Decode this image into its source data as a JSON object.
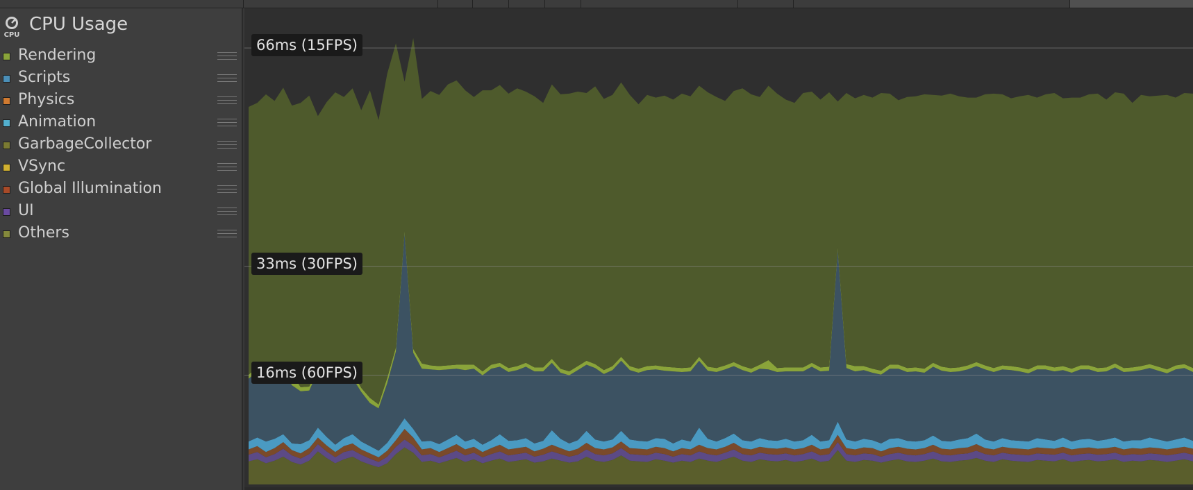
{
  "module": {
    "title": "CPU Usage",
    "icon": "cpu-gauge-icon",
    "icon_caption": "CPU"
  },
  "legend": [
    {
      "label": "Rendering",
      "color": "#8aa43a"
    },
    {
      "label": "Scripts",
      "color": "#4b8fb8"
    },
    {
      "label": "Physics",
      "color": "#d07a30"
    },
    {
      "label": "Animation",
      "color": "#53b0cf"
    },
    {
      "label": "GarbageCollector",
      "color": "#7a7a32"
    },
    {
      "label": "VSync",
      "color": "#d0b030"
    },
    {
      "label": "Global Illumination",
      "color": "#a84a28"
    },
    {
      "label": "UI",
      "color": "#6a4aa0"
    },
    {
      "label": "Others",
      "color": "#858a3c"
    }
  ],
  "chart_data": {
    "type": "area",
    "ylim": [
      0,
      72
    ],
    "y_markers": [
      {
        "label": "66ms (15FPS)",
        "value": 66
      },
      {
        "label": "33ms (30FPS)",
        "value": 33
      },
      {
        "label": "16ms (60FPS)",
        "value": 16.5
      }
    ],
    "series": [
      {
        "name": "Others",
        "color": "#5a5e2c",
        "values": [
          3.5,
          3.8,
          3.2,
          3.6,
          4.2,
          3.4,
          3.0,
          3.6,
          5.0,
          4.0,
          3.2,
          3.8,
          4.2,
          3.5,
          3.0,
          2.6,
          3.2,
          4.6,
          5.6,
          4.8,
          3.4,
          3.6,
          3.2,
          3.6,
          4.0,
          3.4,
          3.8,
          3.2,
          3.6,
          3.9,
          3.4,
          3.6,
          3.8,
          3.3,
          3.5,
          3.9,
          3.6,
          3.3,
          3.5,
          4.2,
          3.6,
          3.4,
          3.7,
          4.4,
          3.6,
          3.5,
          3.4,
          3.8,
          3.6,
          3.3,
          3.6,
          3.4,
          3.9,
          3.6,
          3.4,
          3.8,
          4.2,
          3.6,
          3.4,
          3.8,
          3.6,
          3.5,
          3.7,
          3.4,
          3.6,
          3.9,
          3.4,
          3.6,
          5.2,
          3.6,
          3.4,
          3.7,
          3.6,
          3.3,
          3.6,
          3.8,
          3.5,
          3.4,
          3.6,
          3.9,
          3.5,
          3.4,
          3.6,
          3.7,
          4.0,
          3.6,
          3.4,
          3.8,
          3.6,
          3.5,
          3.4,
          3.7,
          3.6,
          3.5,
          3.8,
          3.4,
          3.6,
          3.7,
          3.5,
          3.6,
          3.8,
          3.4,
          3.6,
          3.5,
          3.7,
          3.6,
          3.4,
          3.6,
          3.8,
          3.5
        ]
      },
      {
        "name": "UI",
        "color": "#5c4a86",
        "values": [
          1.0,
          1.1,
          0.9,
          1.0,
          1.2,
          1.0,
          0.9,
          1.0,
          1.1,
          1.0,
          0.9,
          1.1,
          1.0,
          1.0,
          0.9,
          0.8,
          1.0,
          1.1,
          1.2,
          1.1,
          1.0,
          1.0,
          0.9,
          1.0,
          1.1,
          1.0,
          1.0,
          0.9,
          1.0,
          1.1,
          1.0,
          1.0,
          1.0,
          0.9,
          1.0,
          1.1,
          1.0,
          0.9,
          1.0,
          1.1,
          1.0,
          1.0,
          1.0,
          1.1,
          1.0,
          1.0,
          1.0,
          1.0,
          1.0,
          0.9,
          1.0,
          1.0,
          1.1,
          1.0,
          1.0,
          1.0,
          1.1,
          1.0,
          1.0,
          1.0,
          1.0,
          1.0,
          1.0,
          1.0,
          1.0,
          1.1,
          1.0,
          1.0,
          1.2,
          1.0,
          1.0,
          1.0,
          1.0,
          0.9,
          1.0,
          1.0,
          1.0,
          1.0,
          1.0,
          1.1,
          1.0,
          1.0,
          1.0,
          1.0,
          1.1,
          1.0,
          1.0,
          1.0,
          1.0,
          1.0,
          1.0,
          1.0,
          1.0,
          1.0,
          1.0,
          1.0,
          1.0,
          1.0,
          1.0,
          1.0,
          1.0,
          1.0,
          1.0,
          1.0,
          1.0,
          1.0,
          1.0,
          1.0,
          1.0,
          1.0
        ]
      },
      {
        "name": "Global Illumination",
        "color": "#7a4a2a",
        "values": [
          0.8,
          0.9,
          0.8,
          0.9,
          1.0,
          0.8,
          0.8,
          0.9,
          1.0,
          0.9,
          0.8,
          0.9,
          1.0,
          0.8,
          0.8,
          0.7,
          0.9,
          1.0,
          1.6,
          1.2,
          0.9,
          0.9,
          0.8,
          0.9,
          1.0,
          0.9,
          0.9,
          0.8,
          0.9,
          1.0,
          0.9,
          0.9,
          0.9,
          0.8,
          0.9,
          1.0,
          0.9,
          0.8,
          0.9,
          1.0,
          0.9,
          0.9,
          0.9,
          1.0,
          0.9,
          0.9,
          0.9,
          0.9,
          0.9,
          0.8,
          0.9,
          0.9,
          1.0,
          0.9,
          0.9,
          0.9,
          1.0,
          0.9,
          0.9,
          0.9,
          0.9,
          0.9,
          0.9,
          0.9,
          0.9,
          1.0,
          0.9,
          0.9,
          1.1,
          0.9,
          0.9,
          0.9,
          0.9,
          0.8,
          0.9,
          0.9,
          0.9,
          0.9,
          0.9,
          1.0,
          0.9,
          0.9,
          0.9,
          0.9,
          1.0,
          0.9,
          0.9,
          0.9,
          0.9,
          0.9,
          0.9,
          0.9,
          0.9,
          0.9,
          0.9,
          0.9,
          0.9,
          0.9,
          0.9,
          0.9,
          0.9,
          0.9,
          0.9,
          0.9,
          0.9,
          0.9,
          0.9,
          0.9,
          0.9,
          0.9
        ]
      },
      {
        "name": "Animation",
        "color": "#4a9ac2",
        "values": [
          1.2,
          1.3,
          1.6,
          1.4,
          1.2,
          1.0,
          1.4,
          1.2,
          1.5,
          1.3,
          1.1,
          1.2,
          1.4,
          1.2,
          1.1,
          1.0,
          1.2,
          1.4,
          1.6,
          1.3,
          1.2,
          1.1,
          1.2,
          1.3,
          1.4,
          1.2,
          1.2,
          1.1,
          1.2,
          1.6,
          1.3,
          1.2,
          1.3,
          1.2,
          1.2,
          2.2,
          1.4,
          1.2,
          1.3,
          1.8,
          1.3,
          1.2,
          1.2,
          1.6,
          1.3,
          1.2,
          1.2,
          1.3,
          1.4,
          1.2,
          1.3,
          1.2,
          2.6,
          1.4,
          1.2,
          1.3,
          1.4,
          1.2,
          1.2,
          1.3,
          1.2,
          1.2,
          1.3,
          1.2,
          1.2,
          1.5,
          1.2,
          1.2,
          2.0,
          1.3,
          1.2,
          1.3,
          1.2,
          1.2,
          1.4,
          1.3,
          1.2,
          1.2,
          1.2,
          1.4,
          1.2,
          1.2,
          1.3,
          1.4,
          1.6,
          1.3,
          1.2,
          1.3,
          1.2,
          1.2,
          1.2,
          1.4,
          1.3,
          1.2,
          1.4,
          1.2,
          1.3,
          1.3,
          1.2,
          1.3,
          1.4,
          1.2,
          1.2,
          1.3,
          1.5,
          1.3,
          1.2,
          1.3,
          1.4,
          1.2
        ]
      },
      {
        "name": "Scripts",
        "color": "#3c5262",
        "values": [
          9.5,
          10.0,
          9.8,
          10.5,
          9.6,
          8.8,
          8.0,
          7.5,
          8.5,
          10.0,
          9.2,
          9.0,
          8.5,
          7.5,
          6.5,
          6.4,
          9.0,
          12.0,
          28.0,
          11.5,
          11.0,
          10.8,
          11.2,
          10.6,
          10.0,
          10.8,
          10.6,
          10.5,
          10.8,
          10.2,
          10.4,
          10.6,
          10.8,
          10.9,
          10.5,
          10.2,
          10.0,
          10.3,
          10.6,
          10.0,
          10.8,
          10.2,
          10.5,
          10.6,
          10.5,
          10.3,
          10.8,
          10.4,
          10.3,
          10.9,
          10.2,
          10.6,
          10.1,
          10.3,
          10.5,
          10.4,
          10.2,
          10.6,
          10.4,
          10.5,
          10.7,
          10.4,
          10.2,
          10.6,
          10.4,
          10.3,
          10.6,
          10.5,
          26.0,
          10.8,
          10.6,
          10.4,
          10.2,
          10.4,
          10.6,
          10.5,
          10.4,
          10.6,
          10.2,
          10.4,
          10.6,
          10.5,
          10.3,
          10.4,
          10.2,
          10.6,
          10.5,
          10.4,
          10.6,
          10.5,
          10.3,
          10.4,
          10.6,
          10.5,
          10.2,
          10.4,
          10.6,
          10.5,
          10.4,
          10.3,
          10.6,
          10.5,
          10.4,
          10.6,
          10.5,
          10.4,
          10.3,
          10.6,
          10.5,
          10.4
        ]
      },
      {
        "name": "Rendering",
        "color": "#8aa43a",
        "values": [
          0.6,
          0.6,
          1.2,
          0.6,
          0.8,
          1.8,
          0.6,
          0.6,
          0.6,
          0.6,
          0.6,
          0.6,
          0.8,
          0.6,
          0.8,
          0.6,
          0.8,
          0.6,
          0.4,
          0.6,
          0.8,
          0.6,
          0.6,
          0.6,
          0.6,
          0.8,
          0.6,
          0.6,
          0.6,
          0.6,
          0.6,
          0.6,
          0.6,
          0.6,
          0.6,
          0.6,
          0.6,
          0.6,
          0.6,
          0.6,
          0.6,
          0.6,
          0.6,
          0.6,
          0.6,
          0.6,
          0.6,
          0.6,
          0.6,
          0.6,
          0.6,
          0.6,
          0.6,
          0.6,
          0.6,
          0.6,
          0.6,
          0.6,
          0.6,
          0.6,
          1.4,
          0.6,
          0.6,
          0.6,
          0.6,
          0.6,
          0.6,
          0.6,
          0.4,
          0.6,
          0.8,
          0.6,
          0.6,
          0.6,
          0.6,
          0.6,
          0.6,
          0.6,
          0.6,
          0.6,
          0.6,
          0.6,
          0.6,
          0.6,
          0.6,
          0.6,
          0.6,
          0.6,
          0.6,
          0.6,
          0.6,
          0.6,
          0.6,
          0.6,
          0.6,
          0.6,
          0.6,
          0.6,
          0.6,
          0.6,
          0.6,
          0.6,
          0.6,
          0.6,
          0.6,
          0.6,
          0.6,
          0.6,
          0.6,
          0.6
        ]
      },
      {
        "name": "VSync",
        "color": "#4e5a2c",
        "values": [
          40.5,
          40.0,
          41.5,
          40.0,
          42.0,
          40.5,
          43.0,
          44.0,
          38.0,
          40.0,
          43.5,
          42.0,
          43.0,
          42.0,
          46.5,
          43.0,
          46.0,
          46.0,
          22.5,
          47.0,
          40.0,
          41.5,
          41.0,
          42.5,
          43.0,
          41.5,
          40.5,
          42.5,
          41.5,
          42.0,
          41.5,
          42.0,
          41.0,
          41.0,
          40.0,
          41.5,
          41.5,
          42.0,
          41.5,
          40.5,
          42.0,
          41.0,
          41.0,
          41.5,
          41.0,
          40.0,
          41.0,
          40.5,
          41.0,
          40.5,
          41.5,
          41.0,
          41.0,
          41.5,
          41.0,
          40.0,
          41.0,
          42.0,
          41.5,
          40.5,
          41.5,
          41.5,
          40.5,
          40.0,
          41.5,
          41.0,
          40.5,
          41.5,
          22.0,
          41.0,
          40.5,
          41.0,
          41.0,
          42.0,
          41.0,
          40.0,
          41.0,
          41.0,
          41.5,
          40.5,
          41.0,
          41.5,
          41.0,
          40.5,
          40.0,
          41.0,
          41.5,
          41.0,
          40.5,
          41.0,
          41.5,
          40.5,
          41.0,
          41.5,
          40.5,
          41.0,
          40.5,
          41.0,
          41.5,
          40.5,
          41.0,
          41.5,
          40.0,
          41.0,
          40.5,
          41.0,
          41.5,
          40.5,
          41.0,
          41.5
        ]
      }
    ]
  }
}
